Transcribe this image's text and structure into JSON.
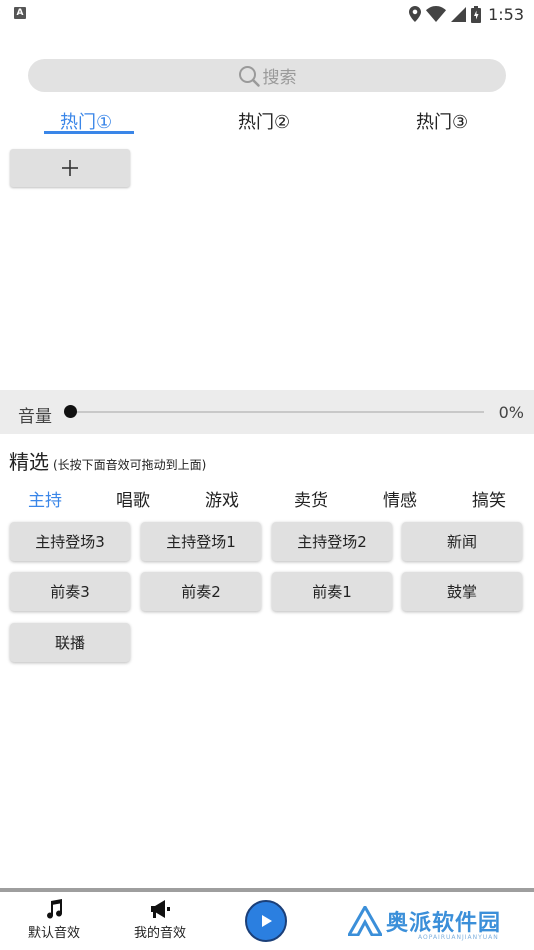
{
  "status_bar": {
    "time": "1:53",
    "notification_letter": "A"
  },
  "search": {
    "placeholder": "搜索"
  },
  "hot_tabs": [
    {
      "label": "热门①"
    },
    {
      "label": "热门②"
    },
    {
      "label": "热门③"
    }
  ],
  "add_button": {
    "symbol": "+"
  },
  "volume": {
    "label": "音量",
    "value_text": "0%",
    "level_percent": 0
  },
  "featured": {
    "title": "精选",
    "hint": "(长按下面音效可拖动到上面)"
  },
  "categories": [
    {
      "label": "主持"
    },
    {
      "label": "唱歌"
    },
    {
      "label": "游戏"
    },
    {
      "label": "卖货"
    },
    {
      "label": "情感"
    },
    {
      "label": "搞笑"
    }
  ],
  "sound_buttons": [
    {
      "label": "主持登场3"
    },
    {
      "label": "主持登场1"
    },
    {
      "label": "主持登场2"
    },
    {
      "label": "新闻"
    },
    {
      "label": "前奏3"
    },
    {
      "label": "前奏2"
    },
    {
      "label": "前奏1"
    },
    {
      "label": "鼓掌"
    },
    {
      "label": "联播"
    }
  ],
  "bottom_nav": {
    "default_sounds": "默认音效",
    "my_sounds": "我的音效"
  },
  "watermark": {
    "text": "奥派软件园",
    "sub": "AOPAIRUANJIANYUAN"
  },
  "colors": {
    "accent": "#3a86e8",
    "play_button": "#2b7fe0"
  }
}
